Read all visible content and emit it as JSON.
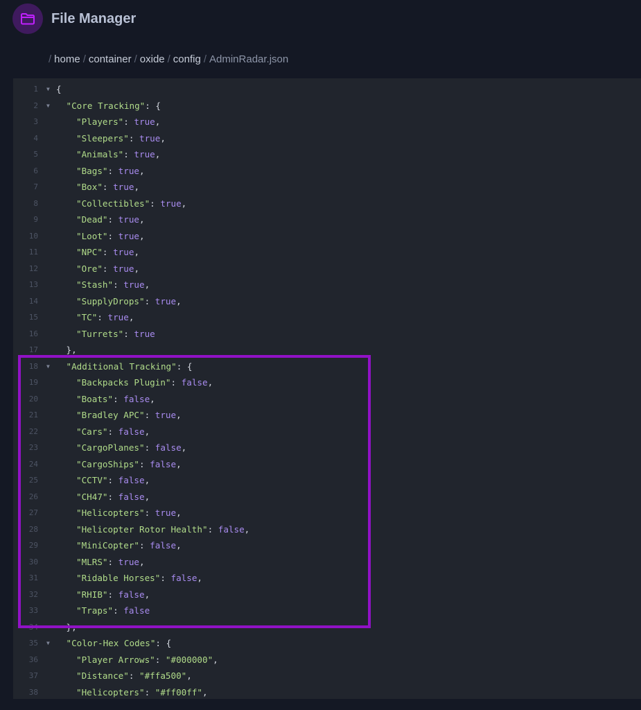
{
  "app": {
    "title": "File Manager",
    "logo_icon": "folder-icon",
    "accent_color": "#9112c6"
  },
  "breadcrumb": [
    {
      "label": "home"
    },
    {
      "label": "container"
    },
    {
      "label": "oxide"
    },
    {
      "label": "config"
    },
    {
      "label": "AdminRadar.json",
      "current": true
    }
  ],
  "editor": {
    "lines": [
      {
        "n": "1",
        "indent": 0,
        "fold": true,
        "tokens": [
          {
            "t": "p",
            "v": "{"
          }
        ]
      },
      {
        "n": "2",
        "indent": 1,
        "fold": true,
        "tokens": [
          {
            "t": "key",
            "v": "\"Core Tracking\""
          },
          {
            "t": "p",
            "v": ": {"
          }
        ]
      },
      {
        "n": "3",
        "indent": 2,
        "tokens": [
          {
            "t": "key",
            "v": "\"Players\""
          },
          {
            "t": "p",
            "v": ": "
          },
          {
            "t": "bool",
            "v": "true"
          },
          {
            "t": "p",
            "v": ","
          }
        ]
      },
      {
        "n": "4",
        "indent": 2,
        "tokens": [
          {
            "t": "key",
            "v": "\"Sleepers\""
          },
          {
            "t": "p",
            "v": ": "
          },
          {
            "t": "bool",
            "v": "true"
          },
          {
            "t": "p",
            "v": ","
          }
        ]
      },
      {
        "n": "5",
        "indent": 2,
        "tokens": [
          {
            "t": "key",
            "v": "\"Animals\""
          },
          {
            "t": "p",
            "v": ": "
          },
          {
            "t": "bool",
            "v": "true"
          },
          {
            "t": "p",
            "v": ","
          }
        ]
      },
      {
        "n": "6",
        "indent": 2,
        "tokens": [
          {
            "t": "key",
            "v": "\"Bags\""
          },
          {
            "t": "p",
            "v": ": "
          },
          {
            "t": "bool",
            "v": "true"
          },
          {
            "t": "p",
            "v": ","
          }
        ]
      },
      {
        "n": "7",
        "indent": 2,
        "tokens": [
          {
            "t": "key",
            "v": "\"Box\""
          },
          {
            "t": "p",
            "v": ": "
          },
          {
            "t": "bool",
            "v": "true"
          },
          {
            "t": "p",
            "v": ","
          }
        ]
      },
      {
        "n": "8",
        "indent": 2,
        "tokens": [
          {
            "t": "key",
            "v": "\"Collectibles\""
          },
          {
            "t": "p",
            "v": ": "
          },
          {
            "t": "bool",
            "v": "true"
          },
          {
            "t": "p",
            "v": ","
          }
        ]
      },
      {
        "n": "9",
        "indent": 2,
        "tokens": [
          {
            "t": "key",
            "v": "\"Dead\""
          },
          {
            "t": "p",
            "v": ": "
          },
          {
            "t": "bool",
            "v": "true"
          },
          {
            "t": "p",
            "v": ","
          }
        ]
      },
      {
        "n": "10",
        "indent": 2,
        "tokens": [
          {
            "t": "key",
            "v": "\"Loot\""
          },
          {
            "t": "p",
            "v": ": "
          },
          {
            "t": "bool",
            "v": "true"
          },
          {
            "t": "p",
            "v": ","
          }
        ]
      },
      {
        "n": "11",
        "indent": 2,
        "tokens": [
          {
            "t": "key",
            "v": "\"NPC\""
          },
          {
            "t": "p",
            "v": ": "
          },
          {
            "t": "bool",
            "v": "true"
          },
          {
            "t": "p",
            "v": ","
          }
        ]
      },
      {
        "n": "12",
        "indent": 2,
        "tokens": [
          {
            "t": "key",
            "v": "\"Ore\""
          },
          {
            "t": "p",
            "v": ": "
          },
          {
            "t": "bool",
            "v": "true"
          },
          {
            "t": "p",
            "v": ","
          }
        ]
      },
      {
        "n": "13",
        "indent": 2,
        "tokens": [
          {
            "t": "key",
            "v": "\"Stash\""
          },
          {
            "t": "p",
            "v": ": "
          },
          {
            "t": "bool",
            "v": "true"
          },
          {
            "t": "p",
            "v": ","
          }
        ]
      },
      {
        "n": "14",
        "indent": 2,
        "tokens": [
          {
            "t": "key",
            "v": "\"SupplyDrops\""
          },
          {
            "t": "p",
            "v": ": "
          },
          {
            "t": "bool",
            "v": "true"
          },
          {
            "t": "p",
            "v": ","
          }
        ]
      },
      {
        "n": "15",
        "indent": 2,
        "tokens": [
          {
            "t": "key",
            "v": "\"TC\""
          },
          {
            "t": "p",
            "v": ": "
          },
          {
            "t": "bool",
            "v": "true"
          },
          {
            "t": "p",
            "v": ","
          }
        ]
      },
      {
        "n": "16",
        "indent": 2,
        "tokens": [
          {
            "t": "key",
            "v": "\"Turrets\""
          },
          {
            "t": "p",
            "v": ": "
          },
          {
            "t": "bool",
            "v": "true"
          }
        ]
      },
      {
        "n": "17",
        "indent": 1,
        "tokens": [
          {
            "t": "p",
            "v": "},"
          }
        ]
      },
      {
        "n": "18",
        "indent": 1,
        "fold": true,
        "tokens": [
          {
            "t": "key",
            "v": "\"Additional Tracking\""
          },
          {
            "t": "p",
            "v": ": {"
          }
        ]
      },
      {
        "n": "19",
        "indent": 2,
        "tokens": [
          {
            "t": "key",
            "v": "\"Backpacks Plugin\""
          },
          {
            "t": "p",
            "v": ": "
          },
          {
            "t": "bool",
            "v": "false"
          },
          {
            "t": "p",
            "v": ","
          }
        ]
      },
      {
        "n": "20",
        "indent": 2,
        "tokens": [
          {
            "t": "key",
            "v": "\"Boats\""
          },
          {
            "t": "p",
            "v": ": "
          },
          {
            "t": "bool",
            "v": "false"
          },
          {
            "t": "p",
            "v": ","
          }
        ]
      },
      {
        "n": "21",
        "indent": 2,
        "tokens": [
          {
            "t": "key",
            "v": "\"Bradley APC\""
          },
          {
            "t": "p",
            "v": ": "
          },
          {
            "t": "bool",
            "v": "true"
          },
          {
            "t": "p",
            "v": ","
          }
        ]
      },
      {
        "n": "22",
        "indent": 2,
        "tokens": [
          {
            "t": "key",
            "v": "\"Cars\""
          },
          {
            "t": "p",
            "v": ": "
          },
          {
            "t": "bool",
            "v": "false"
          },
          {
            "t": "p",
            "v": ","
          }
        ]
      },
      {
        "n": "23",
        "indent": 2,
        "tokens": [
          {
            "t": "key",
            "v": "\"CargoPlanes\""
          },
          {
            "t": "p",
            "v": ": "
          },
          {
            "t": "bool",
            "v": "false"
          },
          {
            "t": "p",
            "v": ","
          }
        ]
      },
      {
        "n": "24",
        "indent": 2,
        "tokens": [
          {
            "t": "key",
            "v": "\"CargoShips\""
          },
          {
            "t": "p",
            "v": ": "
          },
          {
            "t": "bool",
            "v": "false"
          },
          {
            "t": "p",
            "v": ","
          }
        ]
      },
      {
        "n": "25",
        "indent": 2,
        "tokens": [
          {
            "t": "key",
            "v": "\"CCTV\""
          },
          {
            "t": "p",
            "v": ": "
          },
          {
            "t": "bool",
            "v": "false"
          },
          {
            "t": "p",
            "v": ","
          }
        ]
      },
      {
        "n": "26",
        "indent": 2,
        "tokens": [
          {
            "t": "key",
            "v": "\"CH47\""
          },
          {
            "t": "p",
            "v": ": "
          },
          {
            "t": "bool",
            "v": "false"
          },
          {
            "t": "p",
            "v": ","
          }
        ]
      },
      {
        "n": "27",
        "indent": 2,
        "tokens": [
          {
            "t": "key",
            "v": "\"Helicopters\""
          },
          {
            "t": "p",
            "v": ": "
          },
          {
            "t": "bool",
            "v": "true"
          },
          {
            "t": "p",
            "v": ","
          }
        ]
      },
      {
        "n": "28",
        "indent": 2,
        "tokens": [
          {
            "t": "key",
            "v": "\"Helicopter Rotor Health\""
          },
          {
            "t": "p",
            "v": ": "
          },
          {
            "t": "bool",
            "v": "false"
          },
          {
            "t": "p",
            "v": ","
          }
        ]
      },
      {
        "n": "29",
        "indent": 2,
        "tokens": [
          {
            "t": "key",
            "v": "\"MiniCopter\""
          },
          {
            "t": "p",
            "v": ": "
          },
          {
            "t": "bool",
            "v": "false"
          },
          {
            "t": "p",
            "v": ","
          }
        ]
      },
      {
        "n": "30",
        "indent": 2,
        "tokens": [
          {
            "t": "key",
            "v": "\"MLRS\""
          },
          {
            "t": "p",
            "v": ": "
          },
          {
            "t": "bool",
            "v": "true"
          },
          {
            "t": "p",
            "v": ","
          }
        ]
      },
      {
        "n": "31",
        "indent": 2,
        "tokens": [
          {
            "t": "key",
            "v": "\"Ridable Horses\""
          },
          {
            "t": "p",
            "v": ": "
          },
          {
            "t": "bool",
            "v": "false"
          },
          {
            "t": "p",
            "v": ","
          }
        ]
      },
      {
        "n": "32",
        "indent": 2,
        "tokens": [
          {
            "t": "key",
            "v": "\"RHIB\""
          },
          {
            "t": "p",
            "v": ": "
          },
          {
            "t": "bool",
            "v": "false"
          },
          {
            "t": "p",
            "v": ","
          }
        ]
      },
      {
        "n": "33",
        "indent": 2,
        "tokens": [
          {
            "t": "key",
            "v": "\"Traps\""
          },
          {
            "t": "p",
            "v": ": "
          },
          {
            "t": "bool",
            "v": "false"
          }
        ]
      },
      {
        "n": "34",
        "indent": 1,
        "tokens": [
          {
            "t": "p",
            "v": "},"
          }
        ]
      },
      {
        "n": "35",
        "indent": 1,
        "fold": true,
        "tokens": [
          {
            "t": "key",
            "v": "\"Color-Hex Codes\""
          },
          {
            "t": "p",
            "v": ": {"
          }
        ]
      },
      {
        "n": "36",
        "indent": 2,
        "tokens": [
          {
            "t": "key",
            "v": "\"Player Arrows\""
          },
          {
            "t": "p",
            "v": ": "
          },
          {
            "t": "str",
            "v": "\"#000000\""
          },
          {
            "t": "p",
            "v": ","
          }
        ]
      },
      {
        "n": "37",
        "indent": 2,
        "tokens": [
          {
            "t": "key",
            "v": "\"Distance\""
          },
          {
            "t": "p",
            "v": ": "
          },
          {
            "t": "str",
            "v": "\"#ffa500\""
          },
          {
            "t": "p",
            "v": ","
          }
        ]
      },
      {
        "n": "38",
        "indent": 2,
        "tokens": [
          {
            "t": "key",
            "v": "\"Helicopters\""
          },
          {
            "t": "p",
            "v": ": "
          },
          {
            "t": "str",
            "v": "\"#ff00ff\""
          },
          {
            "t": "p",
            "v": ","
          }
        ]
      }
    ]
  }
}
